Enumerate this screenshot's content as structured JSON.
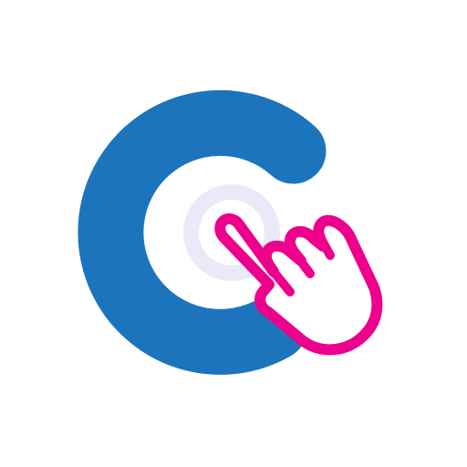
{
  "logo": {
    "icon": "tap-hand-icon",
    "ring_icon": "letter-c-ring-icon",
    "colors": {
      "background": "#ffffff",
      "ring": "#1c75bc",
      "target_circle": "#e9eaf6",
      "hand_outline": "#ec008c",
      "hand_fill": "#ffffff"
    }
  }
}
